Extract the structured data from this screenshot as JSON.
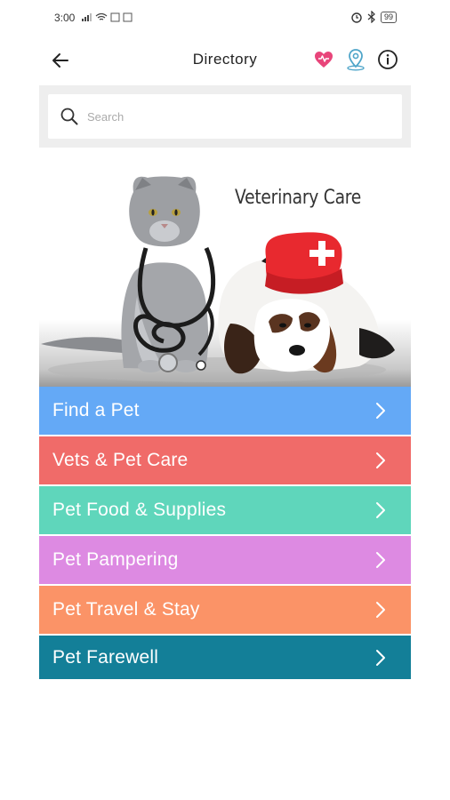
{
  "status_bar": {
    "time": "3:00",
    "battery": "99"
  },
  "header": {
    "title": "Directory"
  },
  "search": {
    "placeholder": "Search"
  },
  "banner": {
    "title": "Veterinary Care"
  },
  "categories": [
    {
      "label": "Find a Pet",
      "color": "#64a9f6"
    },
    {
      "label": "Vets & Pet Care",
      "color": "#f06b69"
    },
    {
      "label": "Pet Food & Supplies",
      "color": "#5fd6bb"
    },
    {
      "label": "Pet Pampering",
      "color": "#dd8ae2"
    },
    {
      "label": "Pet Travel & Stay",
      "color": "#fb9367"
    },
    {
      "label": "Pet Farewell",
      "color": "#137f98"
    }
  ],
  "icons": {
    "back": "arrow-left-icon",
    "favorites": "heart-icon",
    "location": "location-pin-icon",
    "info": "info-icon",
    "search": "search-icon",
    "chevron": "chevron-right-icon"
  },
  "colors": {
    "accent_pink": "#e8457a",
    "accent_teal": "#4fa5c9"
  }
}
